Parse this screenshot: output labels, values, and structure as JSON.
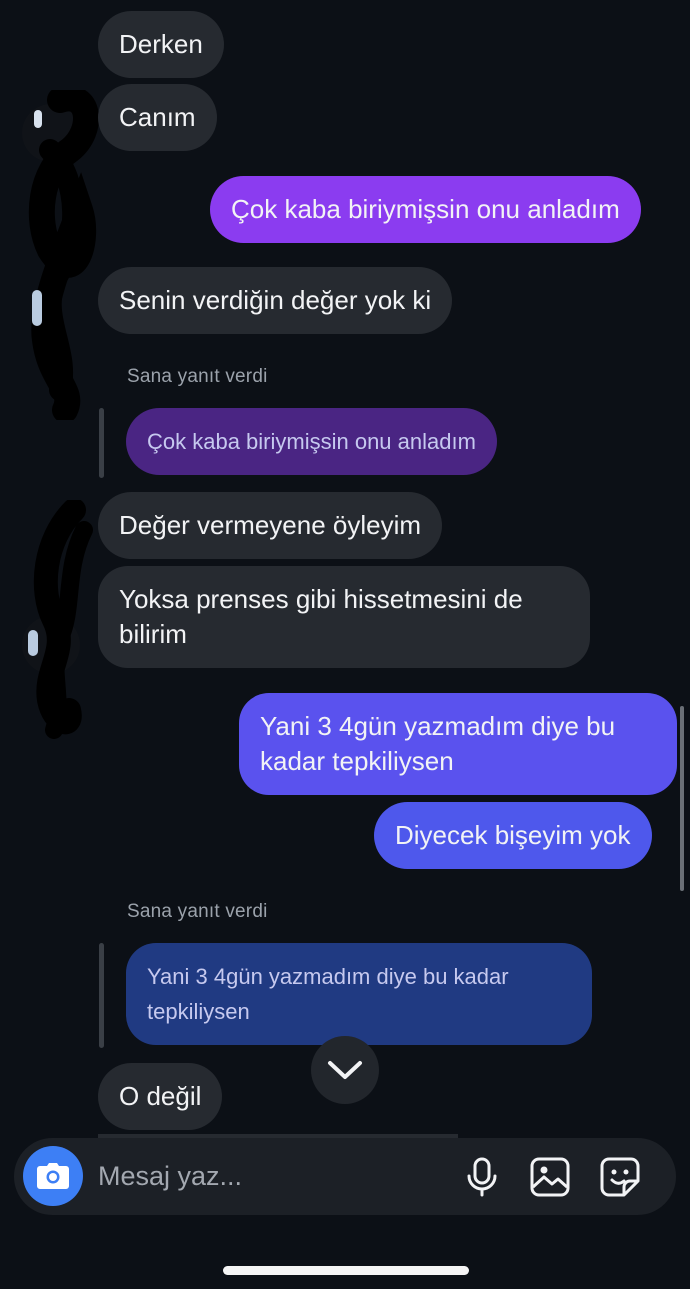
{
  "messages": [
    {
      "text": "Derken"
    },
    {
      "text": "Canım"
    },
    {
      "text": "Çok kaba biriymişsin onu anladım"
    },
    {
      "text": "Senin verdiğin değer yok ki"
    },
    {
      "text": "Değer vermeyene öyleyim"
    },
    {
      "text": "Yoksa prenses gibi hissetmesini de bilirim"
    },
    {
      "text": "Yani 3 4gün yazmadım diye bu kadar tepkiliysen"
    },
    {
      "text": "Diyecek bişeyim yok"
    },
    {
      "text": "O değil"
    }
  ],
  "replies": [
    {
      "label": "Sana yanıt verdi",
      "quoted": "Çok kaba biriymişsin onu anladım"
    },
    {
      "label": "Sana yanıt verdi",
      "quoted": "Yani 3 4gün yazmadım diye bu kadar tepkiliysen"
    }
  ],
  "composer": {
    "placeholder": "Mesaj yaz..."
  },
  "icons": {
    "camera": "camera-icon",
    "microphone": "microphone-icon",
    "gallery": "gallery-icon",
    "sticker": "sticker-icon",
    "scroll_down": "chevron-down-icon"
  },
  "colors": {
    "background": "#0c1016",
    "incoming_bubble": "#262a30",
    "outgoing_purple": "#8b3cf0",
    "outgoing_indigo": "#4e58ec",
    "quote_purple": "#4a2583",
    "quote_navy": "#203a82",
    "camera_button": "#3d7ff5"
  }
}
